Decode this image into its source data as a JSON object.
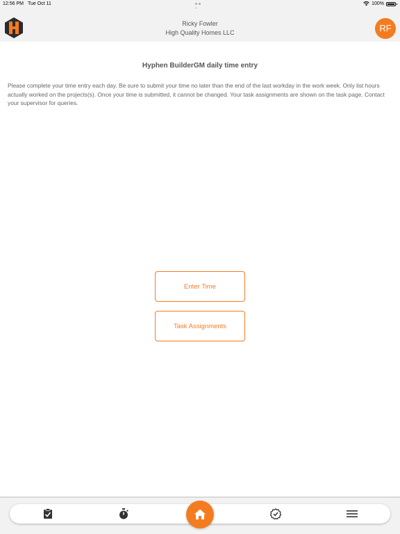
{
  "status_bar": {
    "time": "12:56 PM",
    "date": "Tue Oct 11",
    "battery": "100%",
    "battery_level": 1.0,
    "wifi_icon": "wifi-icon",
    "battery_icon": "battery-icon"
  },
  "header": {
    "user_name": "Ricky Fowler",
    "company": "High Quality Homes LLC",
    "avatar_initials": "RF",
    "logo_icon": "hexagon-h-logo"
  },
  "main": {
    "title": "Hyphen BuilderGM daily time entry",
    "intro": "Please complete your time entry each day. Be sure to submit your time no later than the end of the last workday in the work week. Only list hours actually worked on the projects(s). Once your time is submitted, it cannot be changed. Your task assignments are shown on the task page. Contact your supervisor for queries.",
    "buttons": {
      "enter_time": "Enter Time",
      "task_assignments": "Task Assignments"
    }
  },
  "tab_bar": {
    "items": [
      {
        "icon": "clipboard-check-icon"
      },
      {
        "icon": "stopwatch-icon"
      },
      {
        "icon": "home-icon",
        "active": true
      },
      {
        "icon": "badge-check-icon"
      },
      {
        "icon": "menu-icon"
      }
    ]
  },
  "colors": {
    "accent": "#f47c20",
    "header_bg": "#f2f2f2",
    "text": "#555555"
  }
}
